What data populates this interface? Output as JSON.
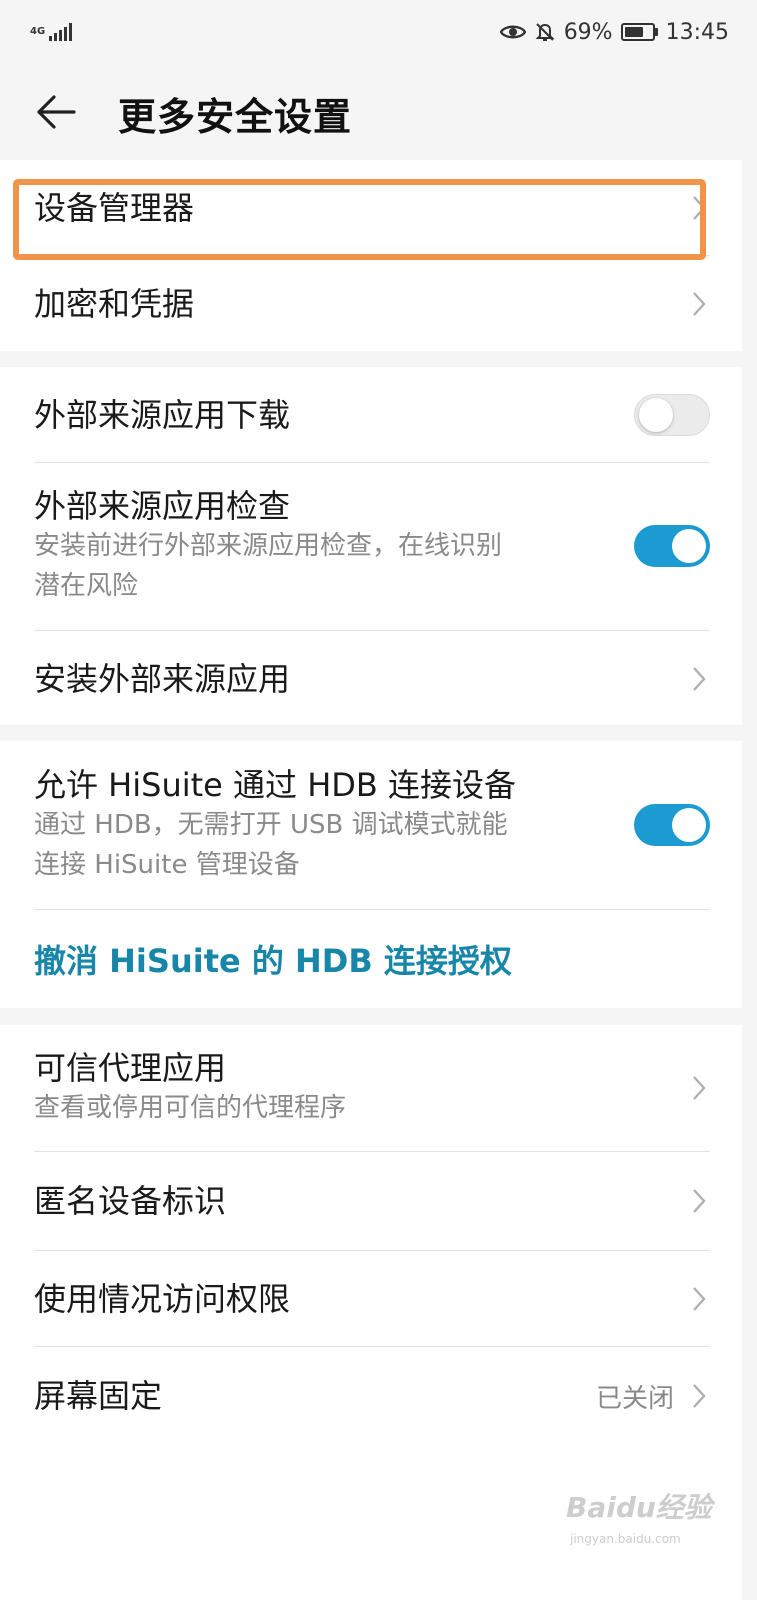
{
  "status_bar": {
    "network": "4G",
    "battery_percent": "69%",
    "battery_level": 0.69,
    "time": "13:45",
    "icons": [
      "signal-icon",
      "eye-icon",
      "bell-off-icon",
      "battery-icon"
    ]
  },
  "header": {
    "title": "更多安全设置",
    "back_icon": "arrow-left-icon"
  },
  "sections": {
    "group1": {
      "device_manager": "设备管理器",
      "encryption": "加密和凭据"
    },
    "group2": {
      "external_download": {
        "title": "外部来源应用下载",
        "enabled": false
      },
      "external_check": {
        "title": "外部来源应用检查",
        "subtitle_line1": "安装前进行外部来源应用检查，在线识别",
        "subtitle_line2": "潜在风险",
        "enabled": true
      },
      "install_external": "安装外部来源应用"
    },
    "group3": {
      "hisuite_hdb": {
        "title": "允许 HiSuite 通过 HDB 连接设备",
        "subtitle_line1": "通过 HDB，无需打开 USB 调试模式就能",
        "subtitle_line2": "连接 HiSuite 管理设备",
        "enabled": true
      },
      "revoke_hdb": "撤消 HiSuite 的 HDB 连接授权"
    },
    "group4": {
      "trust_agents": {
        "title": "可信代理应用",
        "subtitle": "查看或停用可信的代理程序"
      },
      "anonymous_id": "匿名设备标识",
      "usage_access": "使用情况访问权限",
      "screen_pinning": {
        "title": "屏幕固定",
        "value": "已关闭"
      }
    }
  },
  "colors": {
    "accent": "#1b9bd1",
    "link": "#1786a8",
    "highlight": "#f0944a",
    "background": "#f5f5f5"
  },
  "watermark": {
    "brand": "Baidu经验",
    "url": "jingyan.baidu.com"
  }
}
